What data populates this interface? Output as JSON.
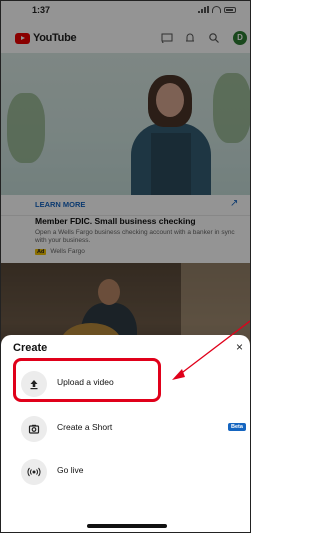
{
  "status": {
    "time": "1:37"
  },
  "header": {
    "app_name": "YouTube",
    "avatar_letter": "D"
  },
  "ad": {
    "cta": "LEARN MORE",
    "title": "Member FDIC. Small business checking",
    "description": "Open a Wells Fargo business checking account with a banker in sync with your business.",
    "badge": "Ad",
    "advertiser": "Wells Fargo"
  },
  "sheet": {
    "title": "Create",
    "close": "×",
    "items": [
      {
        "label": "Upload a video",
        "icon": "upload-icon",
        "glyph": "⬆"
      },
      {
        "label": "Create a Short",
        "icon": "camera-icon",
        "glyph": "◙",
        "badge": "Beta"
      },
      {
        "label": "Go live",
        "icon": "live-icon",
        "glyph": "((•))"
      }
    ]
  },
  "annotation": {
    "color": "#e0001a"
  }
}
